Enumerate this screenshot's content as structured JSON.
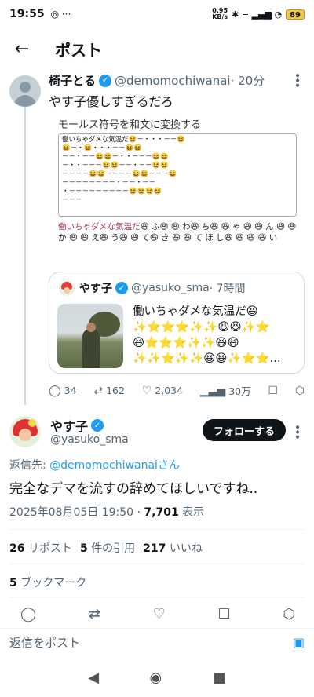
{
  "status": {
    "time": "19:55",
    "left_icons": "◎ ···",
    "speed_value": "0.95",
    "speed_unit": "KB/s",
    "right_icons": "✱ ≡ ▂▄▆ ◔",
    "battery": "89"
  },
  "header": {
    "title": "ポスト",
    "back_icon": "←"
  },
  "quoted_post": {
    "name": "椅子とる",
    "handle": "@demomochiwanai",
    "time": "· 20分",
    "text": "やす子優しすぎるだろ",
    "image": {
      "title": "モールス符号を和文に変換する",
      "morse_lines": [
        "働いちゃダメな気温だ😆－・・・－－😆",
        "😆－・😆・・・－－😆😆",
        "－－・－－😆😆－・・－－－😆😆",
        "－・・－－－😆😆－－・－－😆😆",
        "－－－－😆😆－－－－😆😆－－－😆",
        "－－－－－－－－・－－・－－",
        "・－－－－－－－－－😆😆😆😆",
        "－－－"
      ],
      "result_highlight": "働いちゃダメな気温だ",
      "result_rest": "😆 ふ😆  😆 わ😆 ち😆 😆   ゃ 😆 😆   ん  😆 😆     か  😆 😆 え😆    う😆 😆 て😆 き 😆 😆   て  ほ  し😆 😆 😆 😆    い"
    },
    "replies": "34",
    "reposts": "162",
    "likes": "2,034",
    "views": "30万"
  },
  "embedded_quote": {
    "name": "やす子",
    "handle": "@yasuko_sma",
    "time": "· 7時間",
    "line1": "働いちゃダメな気温だ😆",
    "line2": "✨⭐⭐⭐✨✨😆😆✨⭐",
    "line3": "😆⭐⭐⭐✨✨😆😆",
    "line4": "✨✨⭐✨✨😆😆✨⭐⭐..."
  },
  "main_post": {
    "name": "やす子",
    "handle": "@yasuko_sma",
    "follow_label": "フォローする",
    "reply_to_prefix": "返信先: ",
    "reply_to_link": "@demomochiwanai",
    "reply_to_suffix": "さん",
    "text": "完全なデマを流すの辞めてほしいですね..",
    "datetime": "2025年08月05日 19:50 · ",
    "views_count": "7,701",
    "views_label": " 表示",
    "reposts_count": "26",
    "reposts_label": " リポスト",
    "quotes_count": "5",
    "quotes_label": " 件の引用",
    "likes_count": "217",
    "likes_label": " いいね",
    "bookmarks_count": "5",
    "bookmarks_label": " ブックマーク"
  },
  "reply_bar": {
    "placeholder": "返信をポスト"
  },
  "icons": {
    "reply": "◯",
    "repost": "⇄",
    "like": "♡",
    "views": "▁▃▅",
    "bookmark": "☐",
    "share": "⬡",
    "camera": "▣",
    "nav_back": "◀",
    "nav_home": "◉",
    "nav_recent": "■"
  }
}
